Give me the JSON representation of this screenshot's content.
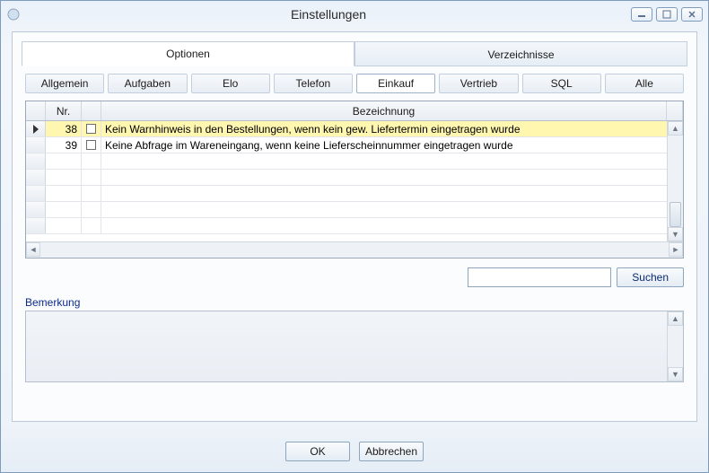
{
  "window": {
    "title": "Einstellungen"
  },
  "maintabs": {
    "options": "Optionen",
    "directories": "Verzeichnisse"
  },
  "subtabs": {
    "allgemein": "Allgemein",
    "aufgaben": "Aufgaben",
    "elo": "Elo",
    "telefon": "Telefon",
    "einkauf": "Einkauf",
    "vertrieb": "Vertrieb",
    "sql": "SQL",
    "alle": "Alle"
  },
  "grid": {
    "headers": {
      "nr": "Nr.",
      "desc": "Bezeichnung"
    },
    "rows": [
      {
        "nr": "38",
        "checked": false,
        "desc": "Kein Warnhinweis in den Bestellungen, wenn kein gew. Liefertermin eingetragen wurde",
        "selected": true
      },
      {
        "nr": "39",
        "checked": false,
        "desc": "Keine Abfrage im Wareneingang, wenn keine Lieferscheinnummer eingetragen wurde",
        "selected": false
      }
    ]
  },
  "search": {
    "value": "",
    "button": "Suchen"
  },
  "remark": {
    "label": "Bemerkung"
  },
  "footer": {
    "ok": "OK",
    "cancel": "Abbrechen"
  }
}
